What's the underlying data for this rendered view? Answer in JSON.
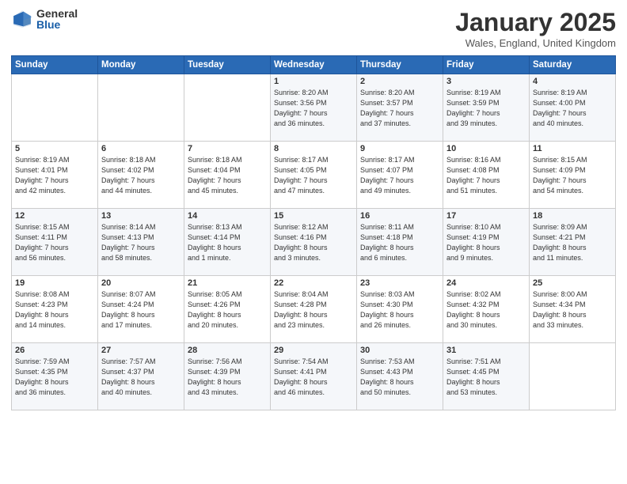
{
  "header": {
    "logo_general": "General",
    "logo_blue": "Blue",
    "title": "January 2025",
    "subtitle": "Wales, England, United Kingdom"
  },
  "weekdays": [
    "Sunday",
    "Monday",
    "Tuesday",
    "Wednesday",
    "Thursday",
    "Friday",
    "Saturday"
  ],
  "weeks": [
    [
      {
        "day": "",
        "info": ""
      },
      {
        "day": "",
        "info": ""
      },
      {
        "day": "",
        "info": ""
      },
      {
        "day": "1",
        "info": "Sunrise: 8:20 AM\nSunset: 3:56 PM\nDaylight: 7 hours\nand 36 minutes."
      },
      {
        "day": "2",
        "info": "Sunrise: 8:20 AM\nSunset: 3:57 PM\nDaylight: 7 hours\nand 37 minutes."
      },
      {
        "day": "3",
        "info": "Sunrise: 8:19 AM\nSunset: 3:59 PM\nDaylight: 7 hours\nand 39 minutes."
      },
      {
        "day": "4",
        "info": "Sunrise: 8:19 AM\nSunset: 4:00 PM\nDaylight: 7 hours\nand 40 minutes."
      }
    ],
    [
      {
        "day": "5",
        "info": "Sunrise: 8:19 AM\nSunset: 4:01 PM\nDaylight: 7 hours\nand 42 minutes."
      },
      {
        "day": "6",
        "info": "Sunrise: 8:18 AM\nSunset: 4:02 PM\nDaylight: 7 hours\nand 44 minutes."
      },
      {
        "day": "7",
        "info": "Sunrise: 8:18 AM\nSunset: 4:04 PM\nDaylight: 7 hours\nand 45 minutes."
      },
      {
        "day": "8",
        "info": "Sunrise: 8:17 AM\nSunset: 4:05 PM\nDaylight: 7 hours\nand 47 minutes."
      },
      {
        "day": "9",
        "info": "Sunrise: 8:17 AM\nSunset: 4:07 PM\nDaylight: 7 hours\nand 49 minutes."
      },
      {
        "day": "10",
        "info": "Sunrise: 8:16 AM\nSunset: 4:08 PM\nDaylight: 7 hours\nand 51 minutes."
      },
      {
        "day": "11",
        "info": "Sunrise: 8:15 AM\nSunset: 4:09 PM\nDaylight: 7 hours\nand 54 minutes."
      }
    ],
    [
      {
        "day": "12",
        "info": "Sunrise: 8:15 AM\nSunset: 4:11 PM\nDaylight: 7 hours\nand 56 minutes."
      },
      {
        "day": "13",
        "info": "Sunrise: 8:14 AM\nSunset: 4:13 PM\nDaylight: 7 hours\nand 58 minutes."
      },
      {
        "day": "14",
        "info": "Sunrise: 8:13 AM\nSunset: 4:14 PM\nDaylight: 8 hours\nand 1 minute."
      },
      {
        "day": "15",
        "info": "Sunrise: 8:12 AM\nSunset: 4:16 PM\nDaylight: 8 hours\nand 3 minutes."
      },
      {
        "day": "16",
        "info": "Sunrise: 8:11 AM\nSunset: 4:18 PM\nDaylight: 8 hours\nand 6 minutes."
      },
      {
        "day": "17",
        "info": "Sunrise: 8:10 AM\nSunset: 4:19 PM\nDaylight: 8 hours\nand 9 minutes."
      },
      {
        "day": "18",
        "info": "Sunrise: 8:09 AM\nSunset: 4:21 PM\nDaylight: 8 hours\nand 11 minutes."
      }
    ],
    [
      {
        "day": "19",
        "info": "Sunrise: 8:08 AM\nSunset: 4:23 PM\nDaylight: 8 hours\nand 14 minutes."
      },
      {
        "day": "20",
        "info": "Sunrise: 8:07 AM\nSunset: 4:24 PM\nDaylight: 8 hours\nand 17 minutes."
      },
      {
        "day": "21",
        "info": "Sunrise: 8:05 AM\nSunset: 4:26 PM\nDaylight: 8 hours\nand 20 minutes."
      },
      {
        "day": "22",
        "info": "Sunrise: 8:04 AM\nSunset: 4:28 PM\nDaylight: 8 hours\nand 23 minutes."
      },
      {
        "day": "23",
        "info": "Sunrise: 8:03 AM\nSunset: 4:30 PM\nDaylight: 8 hours\nand 26 minutes."
      },
      {
        "day": "24",
        "info": "Sunrise: 8:02 AM\nSunset: 4:32 PM\nDaylight: 8 hours\nand 30 minutes."
      },
      {
        "day": "25",
        "info": "Sunrise: 8:00 AM\nSunset: 4:34 PM\nDaylight: 8 hours\nand 33 minutes."
      }
    ],
    [
      {
        "day": "26",
        "info": "Sunrise: 7:59 AM\nSunset: 4:35 PM\nDaylight: 8 hours\nand 36 minutes."
      },
      {
        "day": "27",
        "info": "Sunrise: 7:57 AM\nSunset: 4:37 PM\nDaylight: 8 hours\nand 40 minutes."
      },
      {
        "day": "28",
        "info": "Sunrise: 7:56 AM\nSunset: 4:39 PM\nDaylight: 8 hours\nand 43 minutes."
      },
      {
        "day": "29",
        "info": "Sunrise: 7:54 AM\nSunset: 4:41 PM\nDaylight: 8 hours\nand 46 minutes."
      },
      {
        "day": "30",
        "info": "Sunrise: 7:53 AM\nSunset: 4:43 PM\nDaylight: 8 hours\nand 50 minutes."
      },
      {
        "day": "31",
        "info": "Sunrise: 7:51 AM\nSunset: 4:45 PM\nDaylight: 8 hours\nand 53 minutes."
      },
      {
        "day": "",
        "info": ""
      }
    ]
  ]
}
